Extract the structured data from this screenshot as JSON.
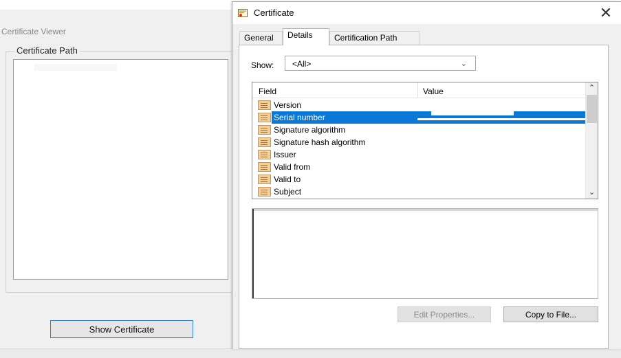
{
  "background_window": {
    "top_tabs": [
      "",
      "",
      "",
      "",
      ""
    ],
    "viewer_title": "Certificate Viewer",
    "group_label": "Certificate Path",
    "show_certificate_button": "Show Certificate"
  },
  "dialog": {
    "title": "Certificate",
    "icon": "certificate-icon",
    "close_glyph": "✕",
    "tabs": [
      {
        "label": "General",
        "active": false
      },
      {
        "label": "Details",
        "active": true
      },
      {
        "label": "Certification Path",
        "active": false
      }
    ],
    "show": {
      "label": "Show:",
      "selected": "<All>"
    },
    "list": {
      "columns": [
        "Field",
        "Value"
      ],
      "rows": [
        {
          "label": "Version",
          "selected": false
        },
        {
          "label": "Serial number",
          "selected": true
        },
        {
          "label": "Signature algorithm",
          "selected": false
        },
        {
          "label": "Signature hash algorithm",
          "selected": false
        },
        {
          "label": "Issuer",
          "selected": false
        },
        {
          "label": "Valid from",
          "selected": false
        },
        {
          "label": "Valid to",
          "selected": false
        },
        {
          "label": "Subject",
          "selected": false
        }
      ]
    },
    "buttons": {
      "edit_properties": "Edit Properties...",
      "copy_to_file": "Copy to File..."
    }
  },
  "colors": {
    "selection": "#0a78d7",
    "focus_border": "#2f7bd8",
    "window_bg": "#f0f0f0"
  }
}
